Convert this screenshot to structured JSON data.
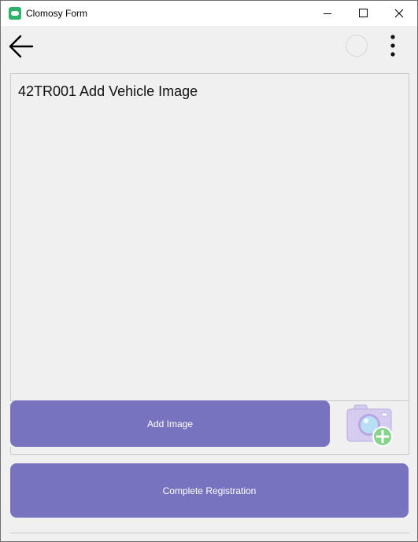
{
  "window": {
    "title": "Clomosy Form",
    "controls": [
      "minimize-icon",
      "maximize-icon",
      "close-icon"
    ]
  },
  "header": {
    "back_icon": "arrow-left-icon",
    "status_icon": "empty-circle-icon",
    "menu_icon": "more-vertical-icon"
  },
  "panel": {
    "title": "42TR001 Add Vehicle Image"
  },
  "actions": {
    "add_image_label": "Add Image",
    "camera_icon": "camera-add-icon",
    "complete_label": "Complete Registration"
  },
  "colors": {
    "accent": "#7773be",
    "background": "#f0f0f0",
    "app_icon": "#2fb36a",
    "camera_body": "#d6ccf0",
    "camera_plus": "#86d38a"
  }
}
